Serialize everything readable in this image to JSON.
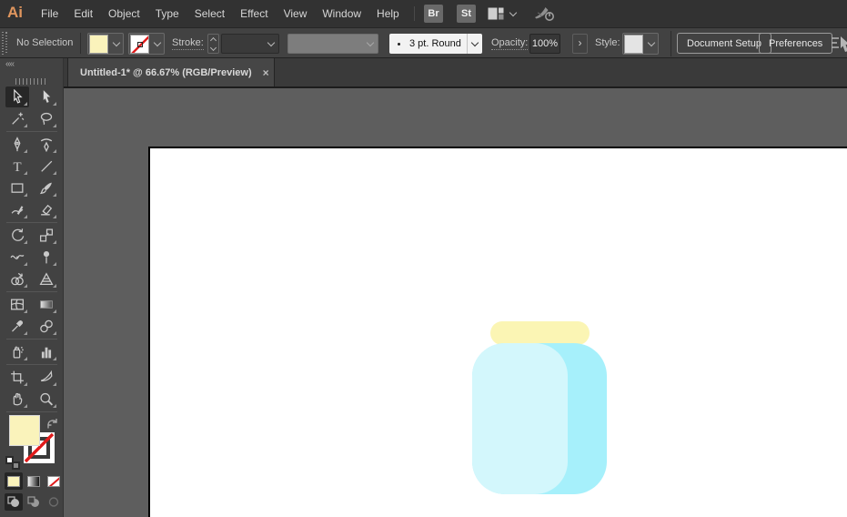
{
  "menu_bar": {
    "logo": "Ai",
    "items": [
      "File",
      "Edit",
      "Object",
      "Type",
      "Select",
      "Effect",
      "View",
      "Window",
      "Help"
    ],
    "bridge_badge": "Br",
    "stock_badge": "St"
  },
  "control_bar": {
    "selection_status": "No Selection",
    "stroke_label": "Stroke:",
    "brush_preset": "3 pt. Round",
    "opacity_label": "Opacity:",
    "opacity_value": "100%",
    "next_glyph": "›",
    "style_label": "Style:",
    "document_setup_button": "Document Setup",
    "preferences_button": "Preferences"
  },
  "document_tab": {
    "title": "Untitled-1* @ 66.67% (RGB/Preview)",
    "close_glyph": "×"
  },
  "tool_panel": {
    "collapse_glyph": "««",
    "active_tool": "selection",
    "layout": [
      [
        "selection",
        "direct-selection"
      ],
      [
        "magic-wand",
        "lasso"
      ],
      "---",
      [
        "pen",
        "curvature"
      ],
      [
        "type",
        "line-segment"
      ],
      [
        "rectangle",
        "paintbrush"
      ],
      [
        "shaper",
        "eraser"
      ],
      "---",
      [
        "rotate",
        "scale"
      ],
      [
        "width",
        "puppet-warp"
      ],
      [
        "shape-builder",
        "perspective-grid"
      ],
      "---",
      [
        "mesh",
        "gradient"
      ],
      [
        "eyedropper",
        "blend"
      ],
      "---",
      [
        "symbol-sprayer",
        "column-graph"
      ],
      "---",
      [
        "artboard",
        "slice"
      ],
      [
        "hand",
        "zoom"
      ],
      "---"
    ]
  },
  "swatches": {
    "fill_color": "#FAF3BB",
    "stroke": "none",
    "style_swatch_color": "#E4E4E4",
    "none_slash_color": "#E01B1B"
  },
  "canvas": {
    "workspace_background": "#5E5E5E",
    "artboard_color": "#FFFFFF",
    "artwork": {
      "name": "jar-illustration",
      "lid_color": "#FBF5B4",
      "body_shade_color": "#A6F0FB",
      "body_light_color": "#D3F7FC"
    }
  },
  "colors": {
    "menu_bar_bg": "#323232",
    "control_bar_bg": "#424242",
    "tab_bar_bg": "#3A3A3A",
    "tab_active_bg": "#464646",
    "panel_bg": "#424242",
    "logo_accent": "#E0965E"
  }
}
